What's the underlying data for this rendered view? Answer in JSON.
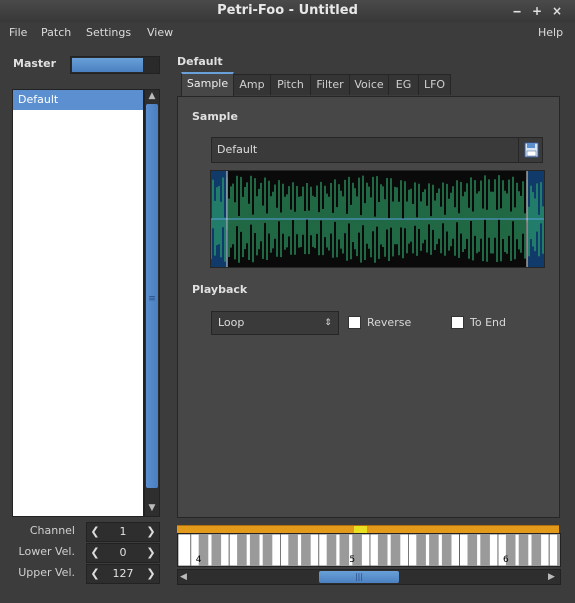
{
  "window": {
    "title": "Petri-Foo - Untitled",
    "buttons": {
      "minimize": "‒",
      "maximize": "+",
      "close": "×"
    }
  },
  "menubar": {
    "items": [
      "File",
      "Patch",
      "Settings",
      "View"
    ],
    "help": "Help"
  },
  "master": {
    "label": "Master",
    "level": 0.82
  },
  "patch_list": {
    "items": [
      "Default"
    ],
    "selected": 0
  },
  "spinners": [
    {
      "label": "Channel",
      "value": "1"
    },
    {
      "label": "Lower Vel.",
      "value": "0"
    },
    {
      "label": "Upper Vel.",
      "value": "127"
    }
  ],
  "patch": {
    "name": "Default"
  },
  "tabs": [
    "Sample",
    "Amp",
    "Pitch",
    "Filter",
    "Voice",
    "EG",
    "LFO"
  ],
  "active_tab": 0,
  "sample": {
    "heading": "Sample",
    "file": "Default"
  },
  "playback": {
    "heading": "Playback",
    "mode": "Loop",
    "reverse_label": "Reverse",
    "reverse": false,
    "to_end_label": "To End",
    "to_end": false
  },
  "keyboard": {
    "octave_labels": [
      "4",
      "5",
      "6"
    ]
  },
  "colors": {
    "accent": "#5b8fcf",
    "waveform": "#2fa86a",
    "waveform_edge": "#1e6fb0",
    "keybar": "#e39a1b"
  }
}
